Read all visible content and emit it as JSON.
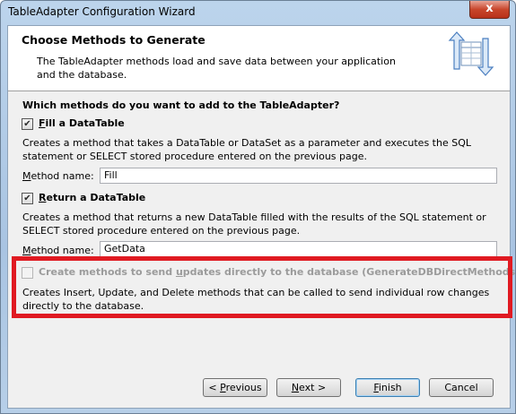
{
  "window": {
    "title": "TableAdapter Configuration Wizard",
    "close_label": "x"
  },
  "header": {
    "title": "Choose Methods to Generate",
    "description": "The TableAdapter methods load and save data between your application and the database."
  },
  "question": "Which methods do you want to add to the TableAdapter?",
  "fill": {
    "checked": true,
    "label_mnemonic": "F",
    "label_rest": "ill a DataTable",
    "description": "Creates a method that takes a DataTable or DataSet as a parameter and executes the SQL statement or SELECT stored procedure entered on the previous page.",
    "method_label_mnemonic": "M",
    "method_label_rest": "ethod name:",
    "method_value": "Fill"
  },
  "return": {
    "checked": true,
    "label_mnemonic": "R",
    "label_rest": "eturn a DataTable",
    "description": "Creates a method that returns a new DataTable filled with the results of the SQL statement or SELECT stored procedure entered on the previous page.",
    "method_label_mnemonic": "M",
    "method_label_rest": "ethod name:",
    "method_value": "GetData"
  },
  "direct": {
    "checked": false,
    "enabled": false,
    "label_pre": "Create methods to send ",
    "label_mnemonic": "u",
    "label_post": "pdates directly to the database (GenerateDBDirectMethods)",
    "description": "Creates Insert, Update, and Delete methods that can be called to send individual row changes directly to the database."
  },
  "buttons": {
    "previous_pre": "< ",
    "previous_mnemonic": "P",
    "previous_rest": "revious",
    "next_mnemonic": "N",
    "next_rest": "ext >",
    "finish_mnemonic": "F",
    "finish_rest": "inish",
    "cancel": "Cancel"
  },
  "colors": {
    "highlight": "#e01a22",
    "title_gradient": "#bcd4ec",
    "client_bg": "#f0f0f0"
  },
  "icons": {
    "header": "wizard-arrows-table-icon",
    "checkmark": "checkmark-icon"
  }
}
